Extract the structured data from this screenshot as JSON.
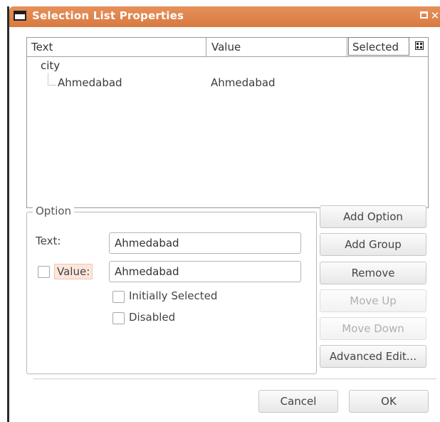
{
  "window": {
    "title": "Selection List Properties",
    "icons": {
      "title": "window-icon",
      "maximize": "maximize-icon",
      "close": "close-icon"
    },
    "accent_color": "#df8549"
  },
  "list": {
    "columns": [
      "Text",
      "Value",
      "Selected"
    ],
    "column_config_icon": "table-config-icon",
    "group": "city",
    "rows": [
      {
        "text": "Ahmedabad",
        "value": "Ahmedabad"
      }
    ]
  },
  "option": {
    "legend": "Option",
    "text_label": "Text:",
    "text_value": "Ahmedabad",
    "value_label": "Value:",
    "value_value": "Ahmedabad",
    "initially_selected_label": "Initially Selected",
    "disabled_label": "Disabled"
  },
  "buttons": {
    "add_option": "Add Option",
    "add_group": "Add Group",
    "remove": "Remove",
    "move_up": "Move Up",
    "move_down": "Move Down",
    "advanced_edit": "Advanced Edit...",
    "cancel": "Cancel",
    "ok": "OK"
  }
}
